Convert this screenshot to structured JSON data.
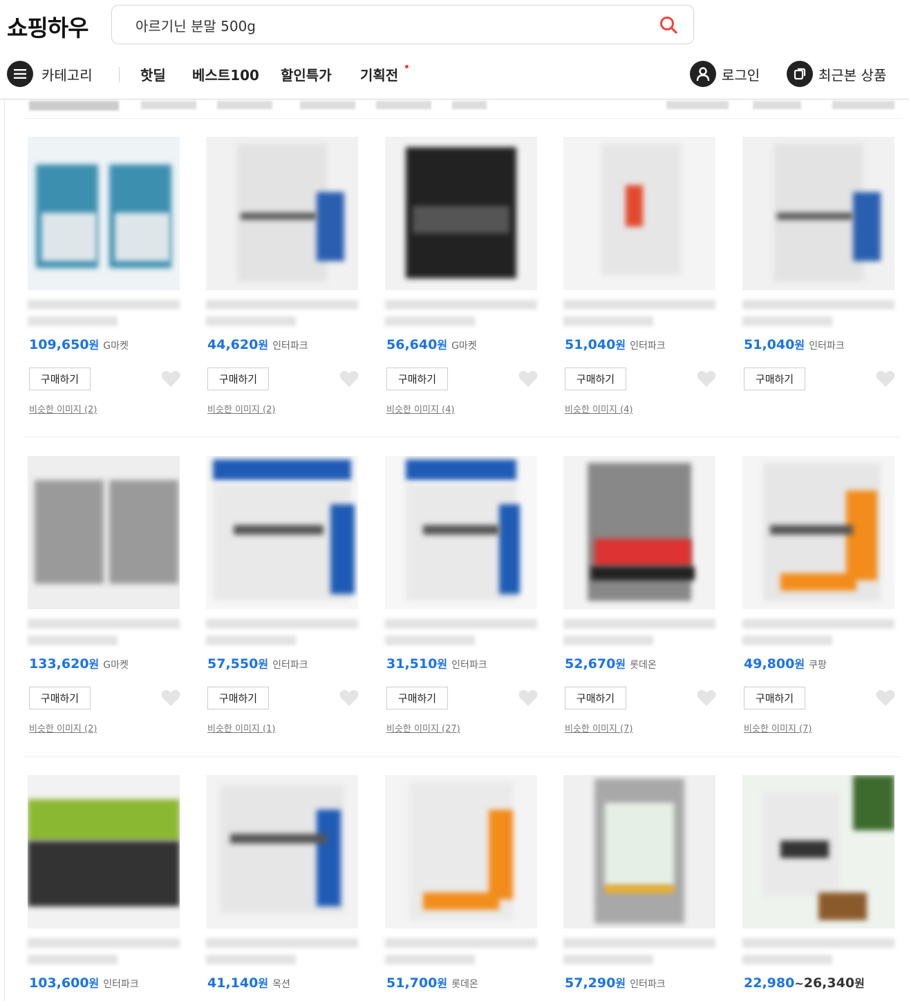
{
  "header": {
    "logo": "쇼핑하우",
    "search_value": "아르기닌 분말 500g"
  },
  "nav": {
    "category": "카테고리",
    "links": [
      "핫딜",
      "베스트100",
      "할인특가",
      "기획전"
    ],
    "login": "로그인",
    "recent": "최근본 상품"
  },
  "buy_label": "구매하기",
  "won": "원",
  "tilde": "~",
  "products": [
    {
      "price": "109,650",
      "seller": "G마켓",
      "similar": "비슷한 이미지 (2)"
    },
    {
      "price": "44,620",
      "seller": "인터파크",
      "similar": "비슷한 이미지 (2)"
    },
    {
      "price": "56,640",
      "seller": "G마켓",
      "similar": "비슷한 이미지 (4)"
    },
    {
      "price": "51,040",
      "seller": "인터파크",
      "similar": "비슷한 이미지 (4)"
    },
    {
      "price": "51,040",
      "seller": "인터파크",
      "similar": ""
    },
    {
      "price": "133,620",
      "seller": "G마켓",
      "similar": "비슷한 이미지 (2)"
    },
    {
      "price": "57,550",
      "seller": "인터파크",
      "similar": "비슷한 이미지 (1)"
    },
    {
      "price": "31,510",
      "seller": "인터파크",
      "similar": "비슷한 이미지 (27)"
    },
    {
      "price": "52,670",
      "seller": "롯데온",
      "similar": "비슷한 이미지 (7)"
    },
    {
      "price": "49,800",
      "seller": "쿠팡",
      "similar": "비슷한 이미지 (7)"
    },
    {
      "price": "103,600",
      "seller": "인터파크",
      "similar": ""
    },
    {
      "price": "41,140",
      "seller": "옥션",
      "similar": ""
    },
    {
      "price": "51,700",
      "seller": "롯데온",
      "similar": ""
    },
    {
      "price": "57,290",
      "seller": "인터파크",
      "similar": ""
    },
    {
      "price": "22,980",
      "price_max": "26,340",
      "seller": "",
      "similar": ""
    }
  ],
  "colors": {
    "price_blue": "#1a73e8",
    "search_icon_red": "#f0443a"
  }
}
